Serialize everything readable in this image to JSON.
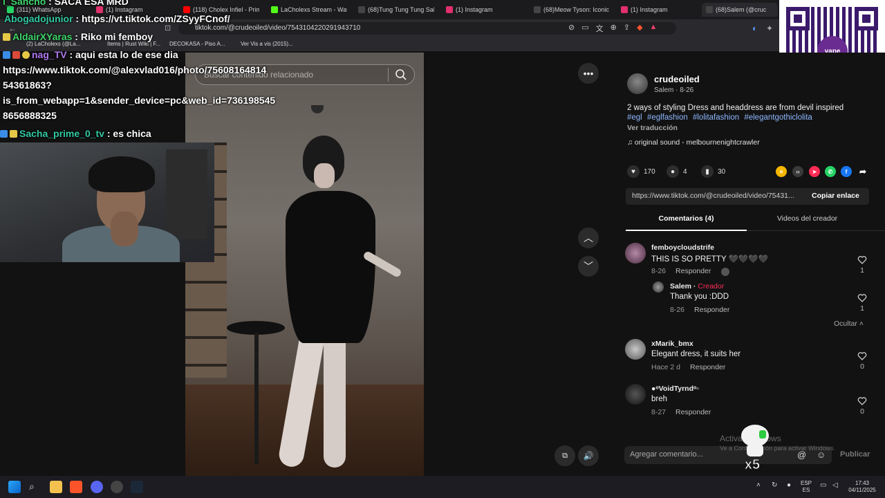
{
  "tabs": [
    {
      "label": "(311) WhatsApp",
      "color": "#25d366"
    },
    {
      "label": "(1) Instagram",
      "color": "#e1306c"
    },
    {
      "label": "(118) Cholex Infiel - Primer",
      "color": "#ff0000"
    },
    {
      "label": "LaCholexs Stream - Watch",
      "color": "#53fc18"
    },
    {
      "label": "(68)Tung Tung Tung Sahu",
      "color": "#ffffff"
    },
    {
      "label": "(1) Instagram",
      "color": "#e1306c"
    },
    {
      "label": "(68)Meow Tyson: Iconic B",
      "color": "#ffffff"
    },
    {
      "label": "(1) Instagram",
      "color": "#e1306c"
    },
    {
      "label": "(68)Salem (@cruc",
      "color": "#ffffff"
    }
  ],
  "address": {
    "url": "tiktok.com/@crudeoiled/video/7543104220291943710"
  },
  "bookmarks": [
    "(2) LaCholexs (@La...",
    "Items | Rust Wiki | F...",
    "DECOKASA - Piso A...",
    "Ver Vis a vis (2015)..."
  ],
  "chat": [
    {
      "user": "l_Sancho",
      "sep": " : ",
      "text": "SACA ESA MRD",
      "color": "usr-green"
    },
    {
      "user": "Abogadojunior",
      "sep": " : ",
      "text": "https://vt.tiktok.com/ZSyyFCnof/",
      "color": "usr-teal"
    },
    {
      "user": "AldairXYaras",
      "sep": " : ",
      "text": "Riko mi femboy",
      "color": "usr-green"
    },
    {
      "user": "nag_TV",
      "sep": " : ",
      "text": "aqui esta lo de ese dia",
      "color": "usr-purple"
    },
    {
      "text": "https://www.tiktok.com/@alexvlad016/photo/75608164814"
    },
    {
      "text": "54361863?"
    },
    {
      "text": "is_from_webapp=1&sender_device=pc&web_id=736198545"
    },
    {
      "text": "8656888325"
    },
    {
      "user": "Sacha_prime_0_tv",
      "sep": " : ",
      "text": "es chica",
      "color": "usr-teal"
    }
  ],
  "qr": {
    "logo": "yape"
  },
  "search": {
    "placeholder": "Buscar contenido relacionado"
  },
  "video": {
    "more_icon": "more-horizontal-icon",
    "up_icon": "chevron-up-icon",
    "down_icon": "chevron-down-icon"
  },
  "author": {
    "name": "crudeoiled",
    "sub": "Salem · 8-26"
  },
  "description": {
    "text": "2 ways of styling Dress and headdress are from devil inspired",
    "tags": [
      "#egl",
      "#eglfashion",
      "#lolitafashion",
      "#elegantgothiclolita"
    ],
    "translate": "Ver traducción",
    "sound": "original sound - melbournenightcrawler"
  },
  "stats": {
    "likes": "170",
    "comments": "4",
    "saves": "30"
  },
  "share": {
    "link": "https://www.tiktok.com/@crudeoiled/video/75431...",
    "copy_label": "Copiar enlace",
    "colors": {
      "coin": "#f5b700",
      "embed": "#3a3a3a",
      "friends": "#fe2c55",
      "whatsapp": "#25d366",
      "facebook": "#1877f2"
    }
  },
  "content_tabs": {
    "comments": "Comentarios (4)",
    "creator_videos": "Videos del creador"
  },
  "comments": [
    {
      "user": "femboycloudstrife",
      "text": "THIS IS SO PRETTY 🖤🖤🖤🖤",
      "date": "8-26",
      "reply": "Responder",
      "likes": "1"
    },
    {
      "user": "Salem",
      "creator": "Creador",
      "text": "Thank you :DDD",
      "date": "8-26",
      "reply": "Responder",
      "likes": "1"
    },
    {
      "user": "xMarik_bmx",
      "text": "Elegant dress, it suits her",
      "date": "Hace 2 d",
      "reply": "Responder",
      "likes": "0"
    },
    {
      "user": "●ᵒVoidTyrndᵒ▫",
      "text": "breh",
      "date": "8-27",
      "reply": "Responder",
      "likes": "0"
    }
  ],
  "hide_label": "Ocultar",
  "comment_box": {
    "placeholder": "Agregar comentario...",
    "publish": "Publicar"
  },
  "watermark": {
    "line1": "Activar Windows",
    "line2": "Ve a Configuración para activar Windows."
  },
  "mascot": {
    "label": "x5"
  },
  "taskbar": {
    "lang_top": "ESP",
    "lang_bottom": "ES",
    "time": "17:43",
    "date": "04/11/2025"
  }
}
